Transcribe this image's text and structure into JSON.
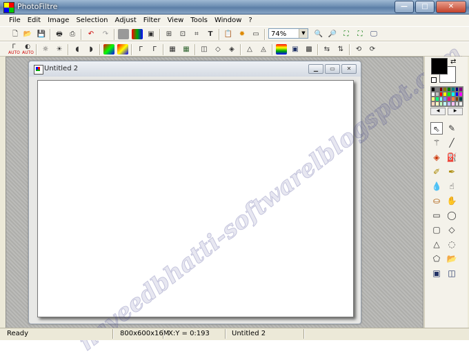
{
  "app": {
    "title": "PhotoFiltre"
  },
  "window_controls": {
    "minimize": "—",
    "maximize": "□",
    "close": "✕"
  },
  "menu": [
    "File",
    "Edit",
    "Image",
    "Selection",
    "Adjust",
    "Filter",
    "View",
    "Tools",
    "Window",
    "?"
  ],
  "toolbar1": {
    "zoom_value": "74%",
    "icons": [
      "new-icon",
      "open-icon",
      "save-icon",
      "print-icon",
      "scan-icon",
      "undo-icon",
      "redo-icon",
      "gray-icon",
      "rgb-icon",
      "invert-icon",
      "image-size-icon",
      "canvas-size-icon",
      "crop-icon",
      "text-icon",
      "paste-icon",
      "settings-icon",
      "fullscreen-icon",
      "zoom-in-icon",
      "zoom-out-icon",
      "zoom-fit-icon",
      "actual-size-icon",
      "slideshow-icon"
    ]
  },
  "toolbar2": {
    "auto_label": "AUTO"
  },
  "document": {
    "title": "Untitled 2",
    "watermark": "naveedbhatti-softwarelblogspot.com"
  },
  "colors": {
    "foreground": "#000000",
    "background": "#ffffff"
  },
  "palette_swatches": [
    "#000000",
    "#808080",
    "#800000",
    "#808000",
    "#008000",
    "#008080",
    "#000080",
    "#800080",
    "#ffffff",
    "#c0c0c0",
    "#ff0000",
    "#ffff00",
    "#00ff00",
    "#00ffff",
    "#0000ff",
    "#ff00ff",
    "#ffff80",
    "#00ff80",
    "#80ffff",
    "#8080ff",
    "#ff0080",
    "#ff8040",
    "#804000",
    "#004040",
    "#ffd8c0",
    "#ffffc0",
    "#c0ffc0",
    "#c0ffff",
    "#c0c0ff",
    "#ffc0ff",
    "#e0e0e0",
    "#f0f0f0"
  ],
  "tools": [
    "pointer-icon",
    "eyedropper-icon",
    "magic-wand-icon",
    "line-icon",
    "fill-icon",
    "spray-icon",
    "brush-icon",
    "advanced-brush-icon",
    "blur-drop-icon",
    "smudge-icon",
    "stamp-icon",
    "hand-icon",
    "rectangle-icon",
    "ellipse-icon",
    "rounded-rect-icon",
    "diamond-icon",
    "triangle-icon",
    "lasso-icon",
    "polygon-icon",
    "folder-icon",
    "select-all-icon",
    "select-invert-icon"
  ],
  "status": {
    "state": "Ready",
    "dimensions": "800x600x16M",
    "coords": "X:Y = 0:193",
    "doc": "Untitled 2"
  }
}
